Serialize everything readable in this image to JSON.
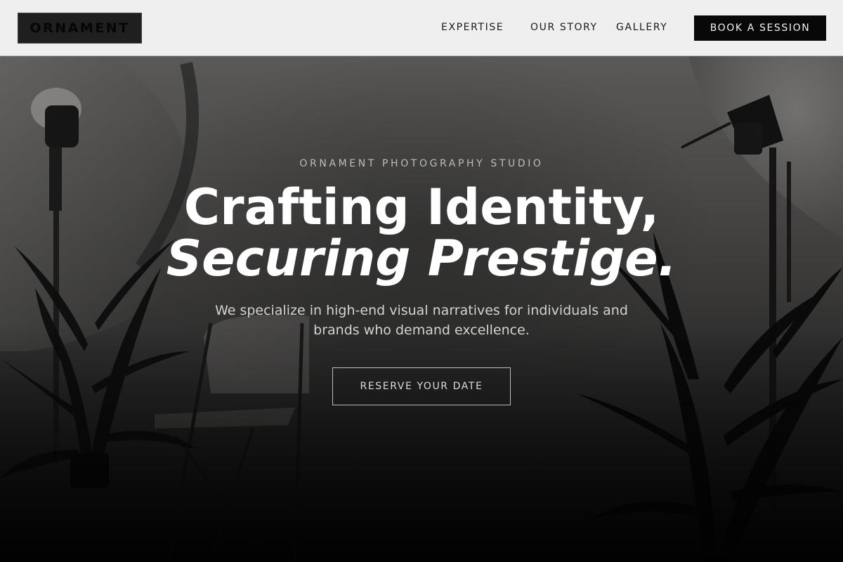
{
  "header": {
    "logo_text": "ORNAMENT",
    "nav": [
      {
        "label": "EXPERTISE"
      },
      {
        "label": "OUR STORY"
      },
      {
        "label": "GALLERY"
      }
    ],
    "cta_label": "BOOK A SESSION"
  },
  "hero": {
    "eyebrow": "ORNAMENT PHOTOGRAPHY STUDIO",
    "headline_line1": "Crafting Identity,",
    "headline_line2": "Securing Prestige.",
    "subtitle": "We specialize in high-end visual narratives for individuals and brands who demand excellence.",
    "cta_label": "RESERVE YOUR DATE"
  },
  "colors": {
    "header_bg": "#efefef",
    "logo_bg": "#1f1f1f",
    "cta_bg": "#080808",
    "hero_text": "#ffffff"
  }
}
